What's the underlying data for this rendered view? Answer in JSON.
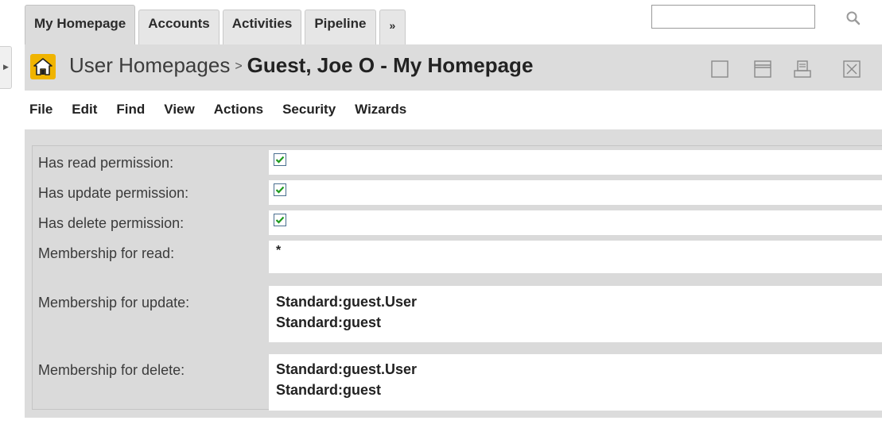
{
  "tabs": [
    {
      "label": "My Homepage",
      "active": true
    },
    {
      "label": "Accounts"
    },
    {
      "label": "Activities"
    },
    {
      "label": "Pipeline"
    },
    {
      "label": "»"
    }
  ],
  "search": {
    "value": "",
    "icon": "search-icon"
  },
  "titlebar": {
    "breadcrumb": "User Homepages",
    "separator": ">",
    "current": "Guest, Joe O - My Homepage",
    "icons": [
      "home-icon",
      "restore-window-icon",
      "maximize-window-icon",
      "print-icon",
      "close-icon"
    ]
  },
  "menu": [
    "File",
    "Edit",
    "Find",
    "View",
    "Actions",
    "Security",
    "Wizards"
  ],
  "form": {
    "read_label": "Has read permission:",
    "read_checked": true,
    "update_label": "Has update permission:",
    "update_checked": true,
    "delete_label": "Has delete permission:",
    "delete_checked": true,
    "membership_read_label": "Membership for read:",
    "membership_read_value": "*",
    "membership_update_label": "Membership for update:",
    "membership_update_values": [
      "Standard:guest.User",
      "Standard:guest"
    ],
    "membership_delete_label": "Membership for delete:",
    "membership_delete_values": [
      "Standard:guest.User",
      "Standard:guest"
    ]
  },
  "colors": {
    "checkmark": "#1f9a1f",
    "home_icon_bg": "#f0b400",
    "panel": "#dcdcdc"
  }
}
